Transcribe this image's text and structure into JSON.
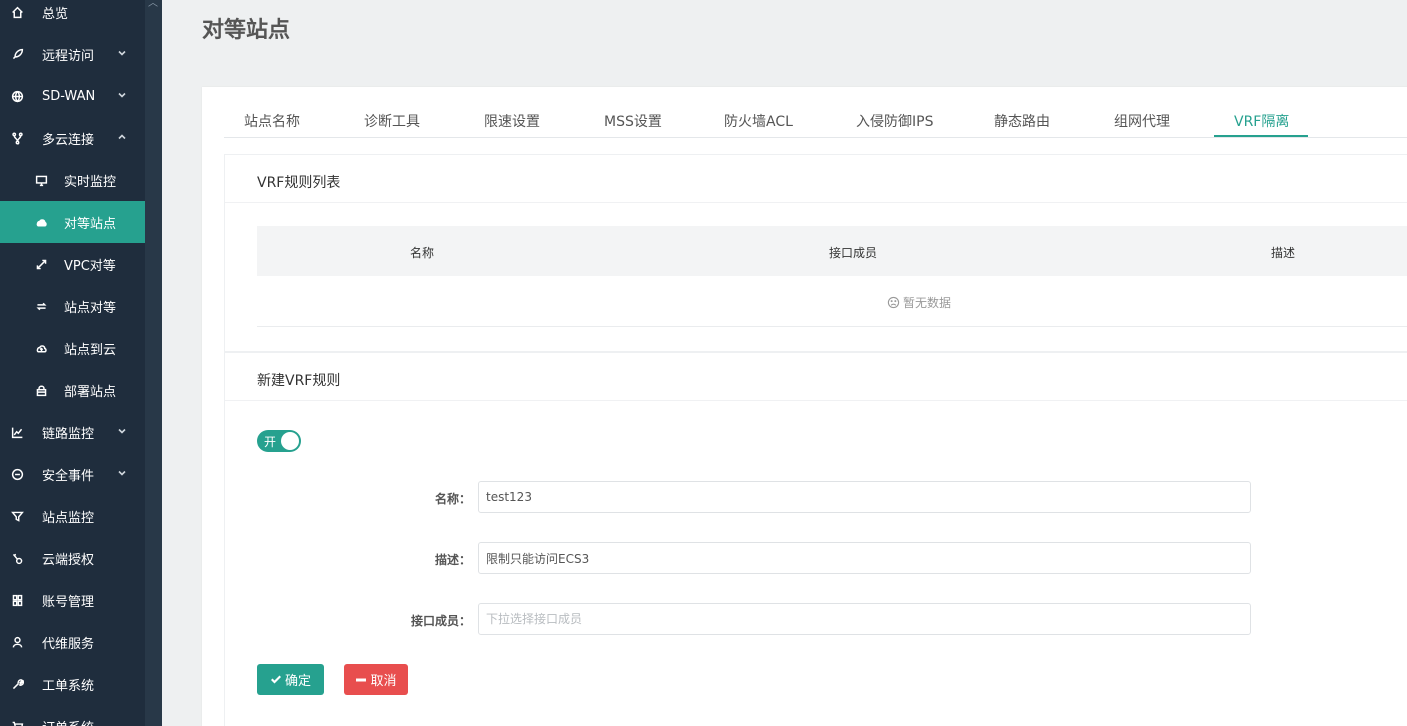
{
  "sidebar": {
    "items": [
      {
        "label": "总览",
        "icon": "home-icon"
      },
      {
        "label": "远程访问",
        "icon": "rocket-icon"
      },
      {
        "label": "SD-WAN",
        "icon": "globe-icon"
      },
      {
        "label": "多云连接",
        "icon": "branch-icon"
      },
      {
        "label": "实时监控",
        "icon": "monitor-icon"
      },
      {
        "label": "对等站点",
        "icon": "cloud-icon"
      },
      {
        "label": "VPC对等",
        "icon": "expand-icon"
      },
      {
        "label": "站点对等",
        "icon": "swap-icon"
      },
      {
        "label": "站点到云",
        "icon": "cloud-upload-icon"
      },
      {
        "label": "部署站点",
        "icon": "lock-box-icon"
      },
      {
        "label": "链路监控",
        "icon": "line-chart-icon"
      },
      {
        "label": "安全事件",
        "icon": "minus-circle-icon"
      },
      {
        "label": "站点监控",
        "icon": "filter-icon"
      },
      {
        "label": "云端授权",
        "icon": "key-icon"
      },
      {
        "label": "账号管理",
        "icon": "group-icon"
      },
      {
        "label": "代维服务",
        "icon": "user-icon"
      },
      {
        "label": "工单系统",
        "icon": "wrench-icon"
      },
      {
        "label": "订单系统",
        "icon": "cart-icon"
      }
    ]
  },
  "page": {
    "title": "对等站点"
  },
  "tabs": [
    "站点名称",
    "诊断工具",
    "限速设置",
    "MSS设置",
    "防火墙ACL",
    "入侵防御IPS",
    "静态路由",
    "组网代理",
    "VRF隔离"
  ],
  "rule_list": {
    "title": "VRF规则列表",
    "columns": [
      "名称",
      "接口成员",
      "描述"
    ],
    "empty_text": "暂无数据"
  },
  "new_rule": {
    "title": "新建VRF规则",
    "toggle_label": "开",
    "name_label": "名称：",
    "name_value": "test123",
    "desc_label": "描述：",
    "desc_value": "限制只能访问ECS3",
    "members_label": "接口成员：",
    "members_placeholder": "下拉选择接口成员",
    "confirm_label": "确定",
    "cancel_label": "取消"
  },
  "colors": {
    "accent": "#26a18f",
    "sidebar_bg": "#1f2d3d",
    "danger": "#e84e4e"
  }
}
